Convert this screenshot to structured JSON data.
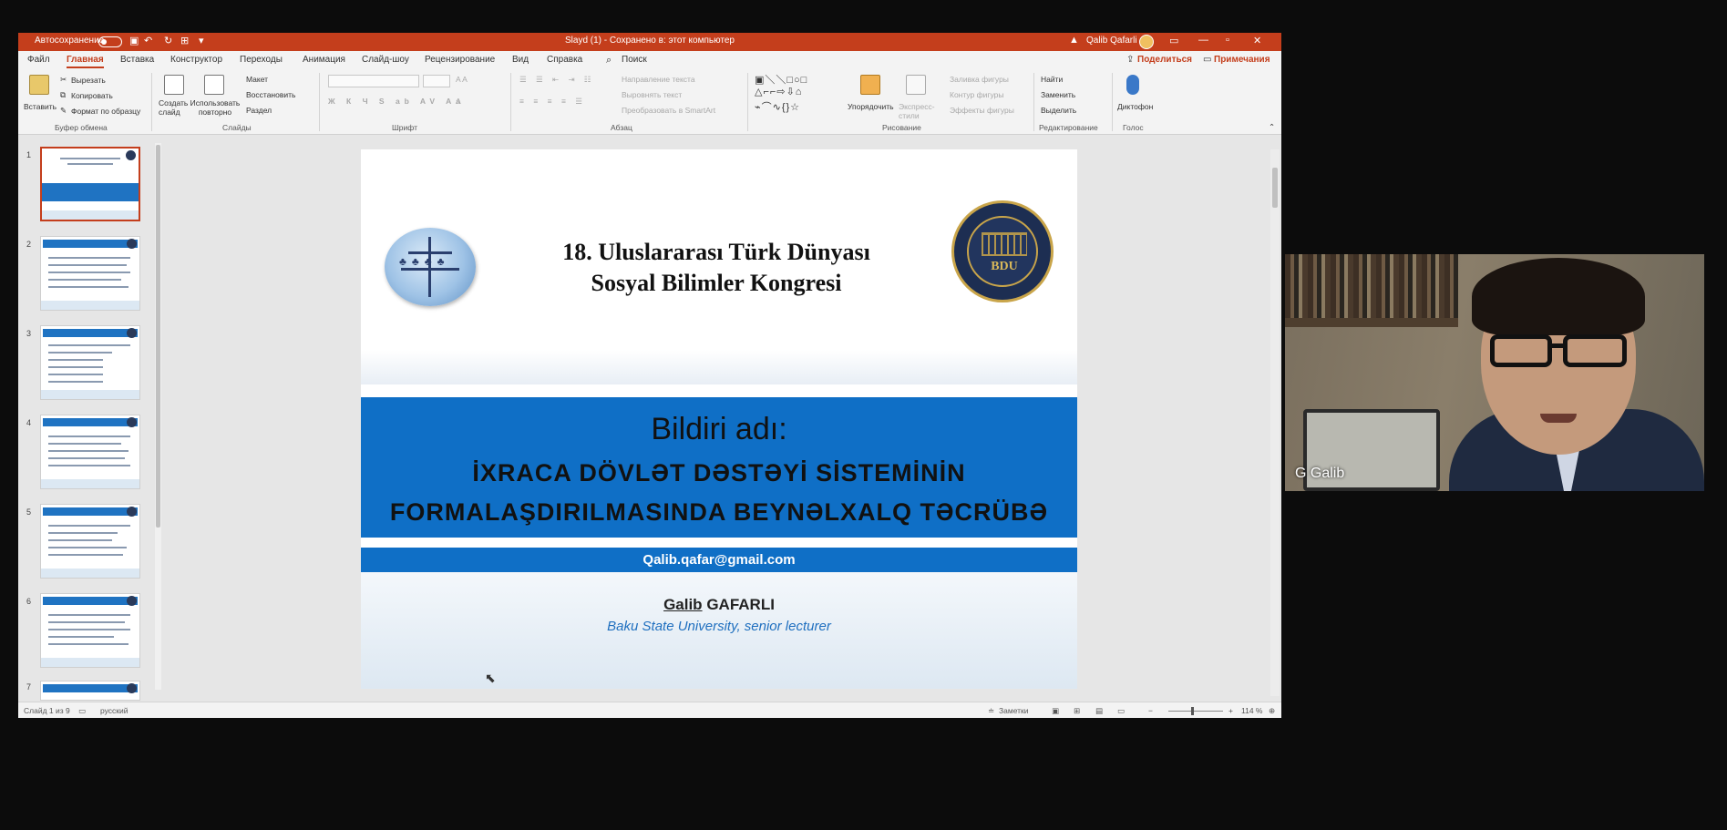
{
  "window": {
    "autosave_label": "Автосохранение",
    "doc_title": "Slayd (1) - Сохранено в: этот компьютер",
    "user_name": "Qalib Qafarli",
    "min": "—",
    "restore": "▫",
    "close": "✕",
    "layout": "▭"
  },
  "tabs": [
    "Файл",
    "Главная",
    "Вставка",
    "Конструктор",
    "Переходы",
    "Анимация",
    "Слайд-шоу",
    "Рецензирование",
    "Вид",
    "Справка"
  ],
  "search_label": "Поиск",
  "share_label": "Поделиться",
  "comments_label": "Примечания",
  "ribbon": {
    "paste": "Вставить",
    "cut": "Вырезать",
    "copy": "Копировать",
    "format_painter": "Формат по образцу",
    "clipboard_group": "Буфер обмена",
    "new_slide": "Создать слайд",
    "reuse": "Использовать повторно",
    "layout": "Макет",
    "reset": "Восстановить",
    "section": "Раздел",
    "slides_group": "Слайды",
    "font_group": "Шрифт",
    "text_direction": "Направление текста",
    "align_text": "Выровнять текст",
    "smartart": "Преобразовать в SmartArt",
    "paragraph_group": "Абзац",
    "arrange": "Упорядочить",
    "quick_styles": "Экспресс-стили",
    "shape_fill": "Заливка фигуры",
    "shape_outline": "Контур фигуры",
    "shape_effects": "Эффекты фигуры",
    "drawing_group": "Рисование",
    "find": "Найти",
    "replace": "Заменить",
    "select": "Выделить",
    "editing_group": "Редактирование",
    "dictate": "Диктофон",
    "voice_group": "Голос"
  },
  "thumbnails": [
    {
      "num": "1"
    },
    {
      "num": "2"
    },
    {
      "num": "3"
    },
    {
      "num": "4"
    },
    {
      "num": "5"
    },
    {
      "num": "6"
    },
    {
      "num": "7"
    }
  ],
  "slide": {
    "congress_line1": "18. Uluslararası Türk Dünyası",
    "congress_line2": "Sosyal Bilimler Kongresi",
    "bildiri": "Bildiri adı:",
    "topic_line1": "İXRACA DÖVLƏT DƏSTƏYİ SİSTEMİNİN",
    "topic_line2": "FORMALAŞDIRILMASINDA BEYNƏLXALQ TƏCRÜBƏ",
    "email": "Qalib.qafar@gmail.com",
    "author_first": "Galib",
    "author_last": "GAFARLI",
    "affiliation": "Baku State University, senior lecturer",
    "logo_right_monogram": "BDU"
  },
  "status": {
    "slide_count": "Слайд 1 из 9",
    "language": "русский",
    "notes": "Заметки",
    "zoom": "114 %"
  },
  "webcam": {
    "participant_name": "G Galib"
  },
  "colors": {
    "accent": "#c43e1c",
    "slide_blue": "#0f6fc6"
  }
}
